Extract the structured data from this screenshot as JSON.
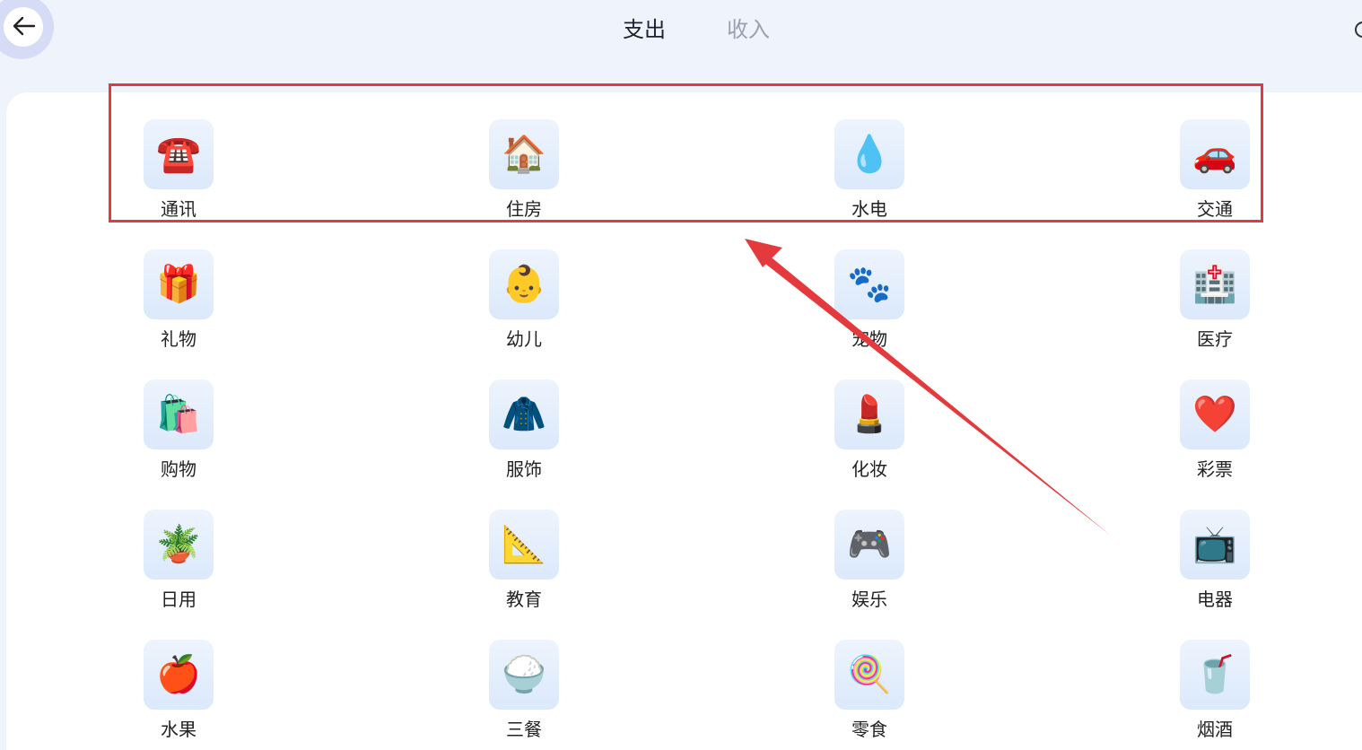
{
  "header": {
    "tabs": [
      {
        "label": "支出",
        "active": true
      },
      {
        "label": "收入",
        "active": false
      }
    ]
  },
  "categories": [
    {
      "label": "通讯",
      "icon": "☎️",
      "icon_name": "telephone-icon"
    },
    {
      "label": "住房",
      "icon": "🏠",
      "icon_name": "house-icon"
    },
    {
      "label": "水电",
      "icon": "💧",
      "icon_name": "water-drop-icon"
    },
    {
      "label": "交通",
      "icon": "🚗",
      "icon_name": "car-icon"
    },
    {
      "label": "礼物",
      "icon": "🎁",
      "icon_name": "gift-icon"
    },
    {
      "label": "幼儿",
      "icon": "👶",
      "icon_name": "baby-icon"
    },
    {
      "label": "宠物",
      "icon": "🐾",
      "icon_name": "paw-prints-icon"
    },
    {
      "label": "医疗",
      "icon": "🏥",
      "icon_name": "hospital-icon"
    },
    {
      "label": "购物",
      "icon": "🛍️",
      "icon_name": "shopping-bags-icon"
    },
    {
      "label": "服饰",
      "icon": "🧥",
      "icon_name": "coat-icon"
    },
    {
      "label": "化妆",
      "icon": "💄",
      "icon_name": "lipstick-icon"
    },
    {
      "label": "彩票",
      "icon": "❤️",
      "icon_name": "heart-icon"
    },
    {
      "label": "日用",
      "icon": "🪴",
      "icon_name": "potted-plant-icon"
    },
    {
      "label": "教育",
      "icon": "📐",
      "icon_name": "triangle-ruler-icon"
    },
    {
      "label": "娱乐",
      "icon": "🎮",
      "icon_name": "game-controller-icon"
    },
    {
      "label": "电器",
      "icon": "📺",
      "icon_name": "television-icon"
    },
    {
      "label": "水果",
      "icon": "🍎",
      "icon_name": "apple-icon"
    },
    {
      "label": "三餐",
      "icon": "🍚",
      "icon_name": "rice-bowl-icon"
    },
    {
      "label": "零食",
      "icon": "🍭",
      "icon_name": "lollipop-icon"
    },
    {
      "label": "烟酒",
      "icon": "🥤",
      "icon_name": "cup-with-straw-icon"
    }
  ],
  "colors": {
    "background": "#eef3fc",
    "annotation": "#e53a3d",
    "tab_active": "#1e2230",
    "tab_inactive": "#9aa0ad"
  }
}
